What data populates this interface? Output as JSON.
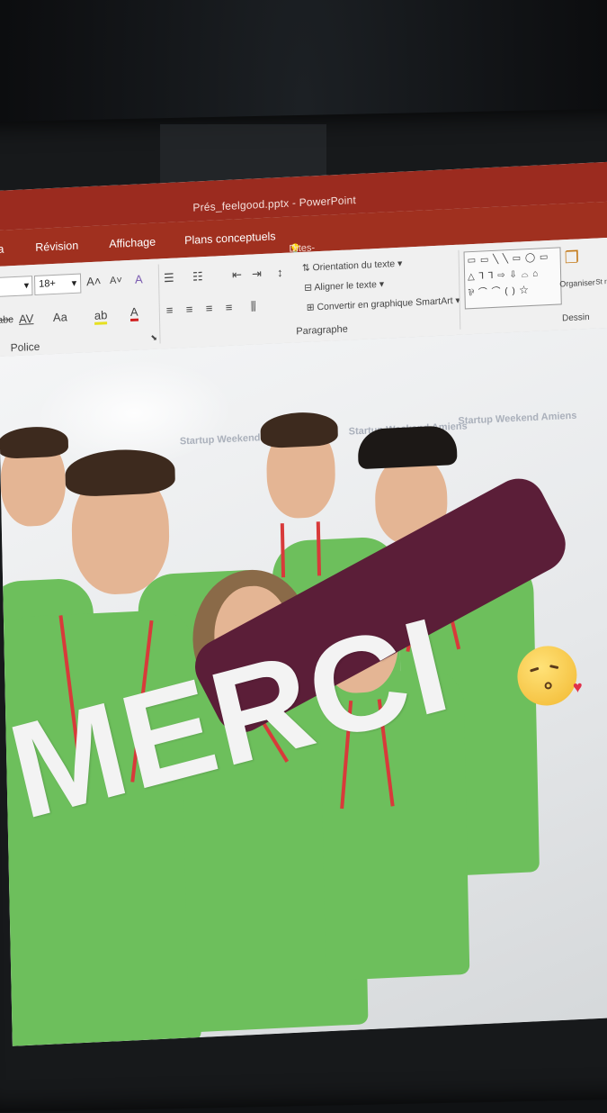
{
  "window": {
    "title": "Prés_feelgood.pptx - PowerPoint"
  },
  "tabs": [
    {
      "label": "a"
    },
    {
      "label": "Révision"
    },
    {
      "label": "Affichage"
    },
    {
      "label": "Plans conceptuels"
    }
  ],
  "tell_me": {
    "label": "Dites-nous ce que vous voulez faire",
    "icon": "lightbulb-icon"
  },
  "ribbon": {
    "font_size": "18+",
    "buttons": {
      "grow_font": "A˄",
      "shrink_font": "A˅",
      "clear_format": "A",
      "char_spacing": "AV",
      "change_case": "Aa",
      "highlight": "ab",
      "font_color": "A",
      "text_shadow": "abc"
    },
    "paragraph": {
      "text_direction": "Orientation du texte",
      "align_text": "Aligner le texte",
      "convert_smartart": "Convertir en graphique SmartArt"
    },
    "groups": {
      "police": "Police",
      "paragraphe": "Paragraphe",
      "dessin": "Dessin"
    },
    "organize": "Organiser",
    "styles_partial": "St rap",
    "shapes_rows": [
      "▭ ▭ ╲ ╲ ▭ ◯ ▭",
      "△ ⅂ ⅂ ⇨ ⇩ ⌓ ⌂",
      "⅌ ⌒ ⌒ ( ) ☆"
    ]
  },
  "slide": {
    "headline": "MERCI",
    "logo_text": "Startup Weekend Amiens",
    "emoji": "kissing-face-emoji"
  }
}
